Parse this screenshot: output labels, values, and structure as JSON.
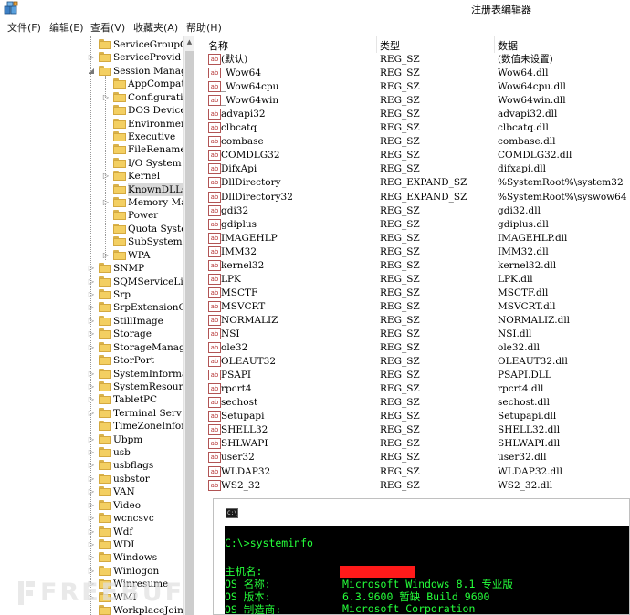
{
  "window": {
    "title": "注册表编辑器"
  },
  "menu": [
    "文件(F)",
    "编辑(E)",
    "查看(V)",
    "收藏夹(A)",
    "帮助(H)"
  ],
  "tree": [
    {
      "label": "ServiceGroupO",
      "level": 1,
      "arrow": ""
    },
    {
      "label": "ServiceProvid",
      "level": 1,
      "arrow": "right"
    },
    {
      "label": "Session Manag",
      "level": 1,
      "arrow": "down"
    },
    {
      "label": "AppCompatCa",
      "level": 2,
      "arrow": ""
    },
    {
      "label": "Configurati",
      "level": 2,
      "arrow": "right"
    },
    {
      "label": "DOS Devices",
      "level": 2,
      "arrow": ""
    },
    {
      "label": "Environment",
      "level": 2,
      "arrow": ""
    },
    {
      "label": "Executive",
      "level": 2,
      "arrow": ""
    },
    {
      "label": "FileRename0",
      "level": 2,
      "arrow": ""
    },
    {
      "label": "I/O System",
      "level": 2,
      "arrow": ""
    },
    {
      "label": "Kernel",
      "level": 2,
      "arrow": "right"
    },
    {
      "label": "KnownDLLs",
      "level": 2,
      "arrow": "",
      "selected": true
    },
    {
      "label": "Memory Mana",
      "level": 2,
      "arrow": "right"
    },
    {
      "label": "Power",
      "level": 2,
      "arrow": ""
    },
    {
      "label": "Quota Syste",
      "level": 2,
      "arrow": ""
    },
    {
      "label": "SubSystems",
      "level": 2,
      "arrow": ""
    },
    {
      "label": "WPA",
      "level": 2,
      "arrow": "right"
    },
    {
      "label": "SNMP",
      "level": 1,
      "arrow": "right"
    },
    {
      "label": "SQMServiceLis",
      "level": 1,
      "arrow": "right"
    },
    {
      "label": "Srp",
      "level": 1,
      "arrow": "right"
    },
    {
      "label": "SrpExtensionC",
      "level": 1,
      "arrow": "right"
    },
    {
      "label": "StillImage",
      "level": 1,
      "arrow": "right"
    },
    {
      "label": "Storage",
      "level": 1,
      "arrow": "right"
    },
    {
      "label": "StorageManage",
      "level": 1,
      "arrow": "right"
    },
    {
      "label": "StorPort",
      "level": 1,
      "arrow": ""
    },
    {
      "label": "SystemInforma",
      "level": 1,
      "arrow": "right"
    },
    {
      "label": "SystemResourc",
      "level": 1,
      "arrow": "right"
    },
    {
      "label": "TabletPC",
      "level": 1,
      "arrow": "right"
    },
    {
      "label": "Terminal Serv",
      "level": 1,
      "arrow": "right"
    },
    {
      "label": "TimeZoneInfor",
      "level": 1,
      "arrow": ""
    },
    {
      "label": "Ubpm",
      "level": 1,
      "arrow": "right"
    },
    {
      "label": "usb",
      "level": 1,
      "arrow": "right"
    },
    {
      "label": "usbflags",
      "level": 1,
      "arrow": "right"
    },
    {
      "label": "usbstor",
      "level": 1,
      "arrow": "right"
    },
    {
      "label": "VAN",
      "level": 1,
      "arrow": "right"
    },
    {
      "label": "Video",
      "level": 1,
      "arrow": "right"
    },
    {
      "label": "wcncsvc",
      "level": 1,
      "arrow": "right"
    },
    {
      "label": "Wdf",
      "level": 1,
      "arrow": "right"
    },
    {
      "label": "WDI",
      "level": 1,
      "arrow": "right"
    },
    {
      "label": "Windows",
      "level": 1,
      "arrow": "right"
    },
    {
      "label": "Winlogon",
      "level": 1,
      "arrow": "right"
    },
    {
      "label": "Winresume",
      "level": 1,
      "arrow": "right"
    },
    {
      "label": "WMI",
      "level": 1,
      "arrow": "right"
    },
    {
      "label": "WorkplaceJoin",
      "level": 1,
      "arrow": ""
    }
  ],
  "columns": {
    "name": "名称",
    "type": "类型",
    "data": "数据"
  },
  "values": [
    {
      "name": "(默认)",
      "type": "REG_SZ",
      "data": "(数值未设置)"
    },
    {
      "name": "_Wow64",
      "type": "REG_SZ",
      "data": "Wow64.dll"
    },
    {
      "name": "_Wow64cpu",
      "type": "REG_SZ",
      "data": "Wow64cpu.dll"
    },
    {
      "name": "_Wow64win",
      "type": "REG_SZ",
      "data": "Wow64win.dll"
    },
    {
      "name": "advapi32",
      "type": "REG_SZ",
      "data": "advapi32.dll"
    },
    {
      "name": "clbcatq",
      "type": "REG_SZ",
      "data": "clbcatq.dll"
    },
    {
      "name": "combase",
      "type": "REG_SZ",
      "data": "combase.dll"
    },
    {
      "name": "COMDLG32",
      "type": "REG_SZ",
      "data": "COMDLG32.dll"
    },
    {
      "name": "DifxApi",
      "type": "REG_SZ",
      "data": "difxapi.dll"
    },
    {
      "name": "DllDirectory",
      "type": "REG_EXPAND_SZ",
      "data": "%SystemRoot%\\system32"
    },
    {
      "name": "DllDirectory32",
      "type": "REG_EXPAND_SZ",
      "data": "%SystemRoot%\\syswow64"
    },
    {
      "name": "gdi32",
      "type": "REG_SZ",
      "data": "gdi32.dll"
    },
    {
      "name": "gdiplus",
      "type": "REG_SZ",
      "data": "gdiplus.dll"
    },
    {
      "name": "IMAGEHLP",
      "type": "REG_SZ",
      "data": "IMAGEHLP.dll"
    },
    {
      "name": "IMM32",
      "type": "REG_SZ",
      "data": "IMM32.dll"
    },
    {
      "name": "kernel32",
      "type": "REG_SZ",
      "data": "kernel32.dll"
    },
    {
      "name": "LPK",
      "type": "REG_SZ",
      "data": "LPK.dll"
    },
    {
      "name": "MSCTF",
      "type": "REG_SZ",
      "data": "MSCTF.dll"
    },
    {
      "name": "MSVCRT",
      "type": "REG_SZ",
      "data": "MSVCRT.dll"
    },
    {
      "name": "NORMALIZ",
      "type": "REG_SZ",
      "data": "NORMALIZ.dll"
    },
    {
      "name": "NSI",
      "type": "REG_SZ",
      "data": "NSI.dll"
    },
    {
      "name": "ole32",
      "type": "REG_SZ",
      "data": "ole32.dll"
    },
    {
      "name": "OLEAUT32",
      "type": "REG_SZ",
      "data": "OLEAUT32.dll"
    },
    {
      "name": "PSAPI",
      "type": "REG_SZ",
      "data": "PSAPI.DLL"
    },
    {
      "name": "rpcrt4",
      "type": "REG_SZ",
      "data": "rpcrt4.dll"
    },
    {
      "name": "sechost",
      "type": "REG_SZ",
      "data": "sechost.dll"
    },
    {
      "name": "Setupapi",
      "type": "REG_SZ",
      "data": "Setupapi.dll"
    },
    {
      "name": "SHELL32",
      "type": "REG_SZ",
      "data": "SHELL32.dll"
    },
    {
      "name": "SHLWAPI",
      "type": "REG_SZ",
      "data": "SHLWAPI.dll"
    },
    {
      "name": "user32",
      "type": "REG_SZ",
      "data": "user32.dll"
    },
    {
      "name": "WLDAP32",
      "type": "REG_SZ",
      "data": "WLDAP32.dll"
    },
    {
      "name": "WS2_32",
      "type": "REG_SZ",
      "data": "WS2_32.dll"
    }
  ],
  "value_icon_text": "ab",
  "console": {
    "icon_text": "C:\\",
    "prompt": "C:\\>systeminfo",
    "lines": [
      {
        "label": "主机名:",
        "value": ""
      },
      {
        "label": "OS 名称:",
        "value": "Microsoft Windows 8.1 专业版"
      },
      {
        "label": "OS 版本:",
        "value": "6.3.9600 暂缺 Build 9600"
      },
      {
        "label": "OS 制造商:",
        "value": "Microsoft Corporation"
      }
    ],
    "text_color": "#25ff3a",
    "redaction_color": "#ff1a1a"
  },
  "watermark": "FREEBUF",
  "colors": {
    "folder": "#f3cf62",
    "selection": "#d9d9d9"
  }
}
